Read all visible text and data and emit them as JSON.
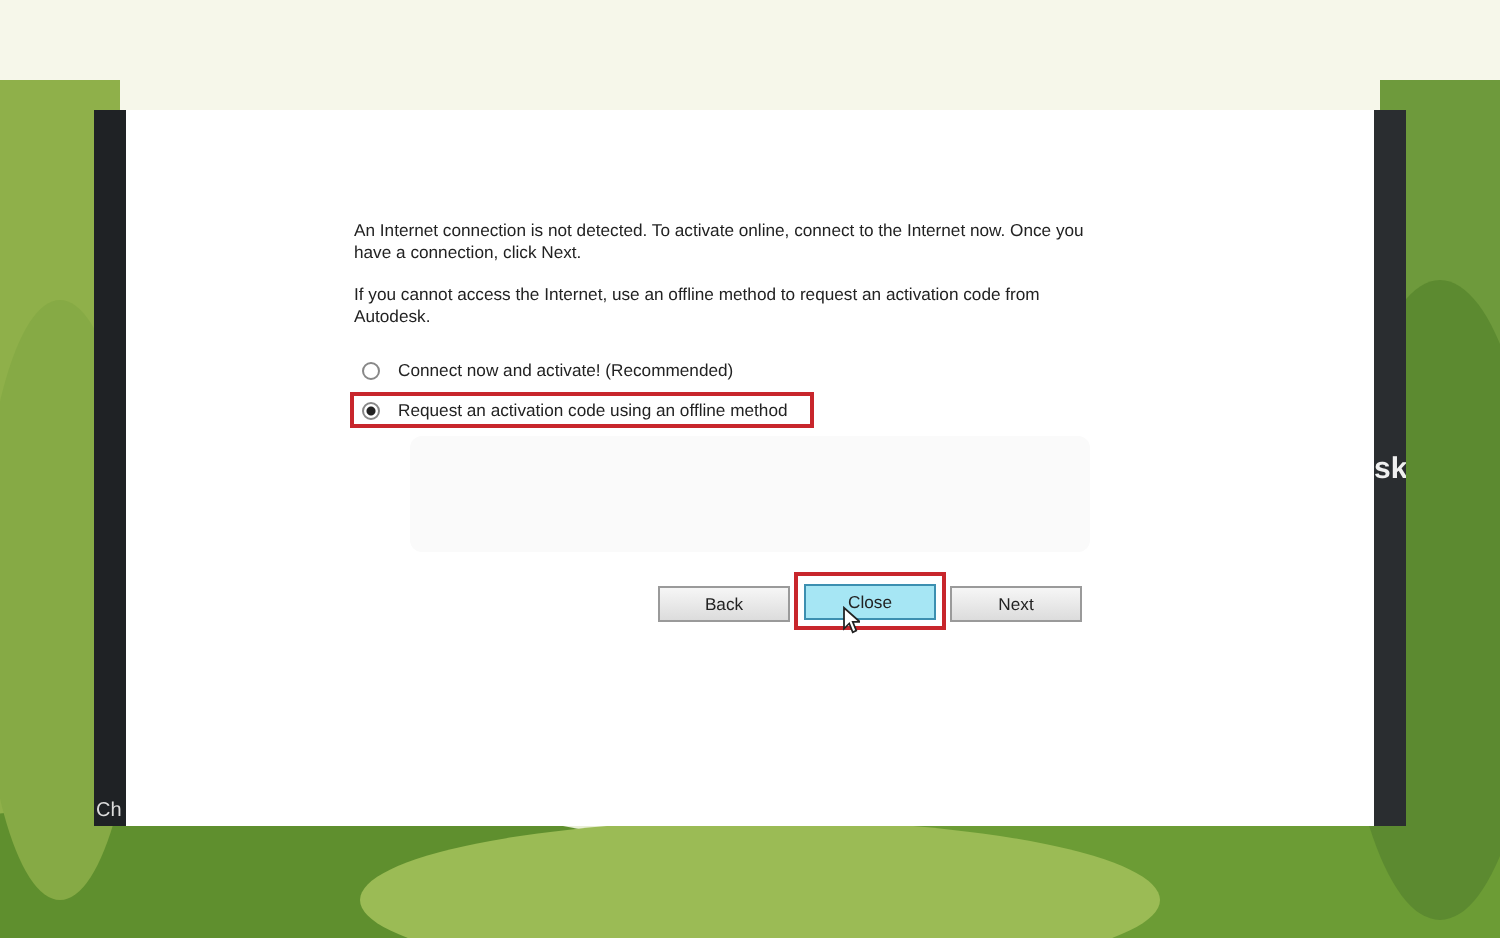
{
  "paragraphs": [
    "An Internet connection is not detected. To activate online, connect to the Internet now. Once you have a connection, click Next.",
    "If you cannot access the Internet, use an offline method to request an activation code from Autodesk."
  ],
  "options": [
    {
      "label": "Connect now and activate! (Recommended)",
      "selected": false,
      "highlighted": false
    },
    {
      "label": "Request an activation code using an offline method",
      "selected": true,
      "highlighted": true
    }
  ],
  "buttons": [
    {
      "label": "Back",
      "selected": false,
      "highlighted": false
    },
    {
      "label": "Close",
      "selected": true,
      "highlighted": true
    },
    {
      "label": "Next",
      "selected": false,
      "highlighted": false
    }
  ],
  "side_text": {
    "left": "Ch",
    "right": "sk"
  }
}
